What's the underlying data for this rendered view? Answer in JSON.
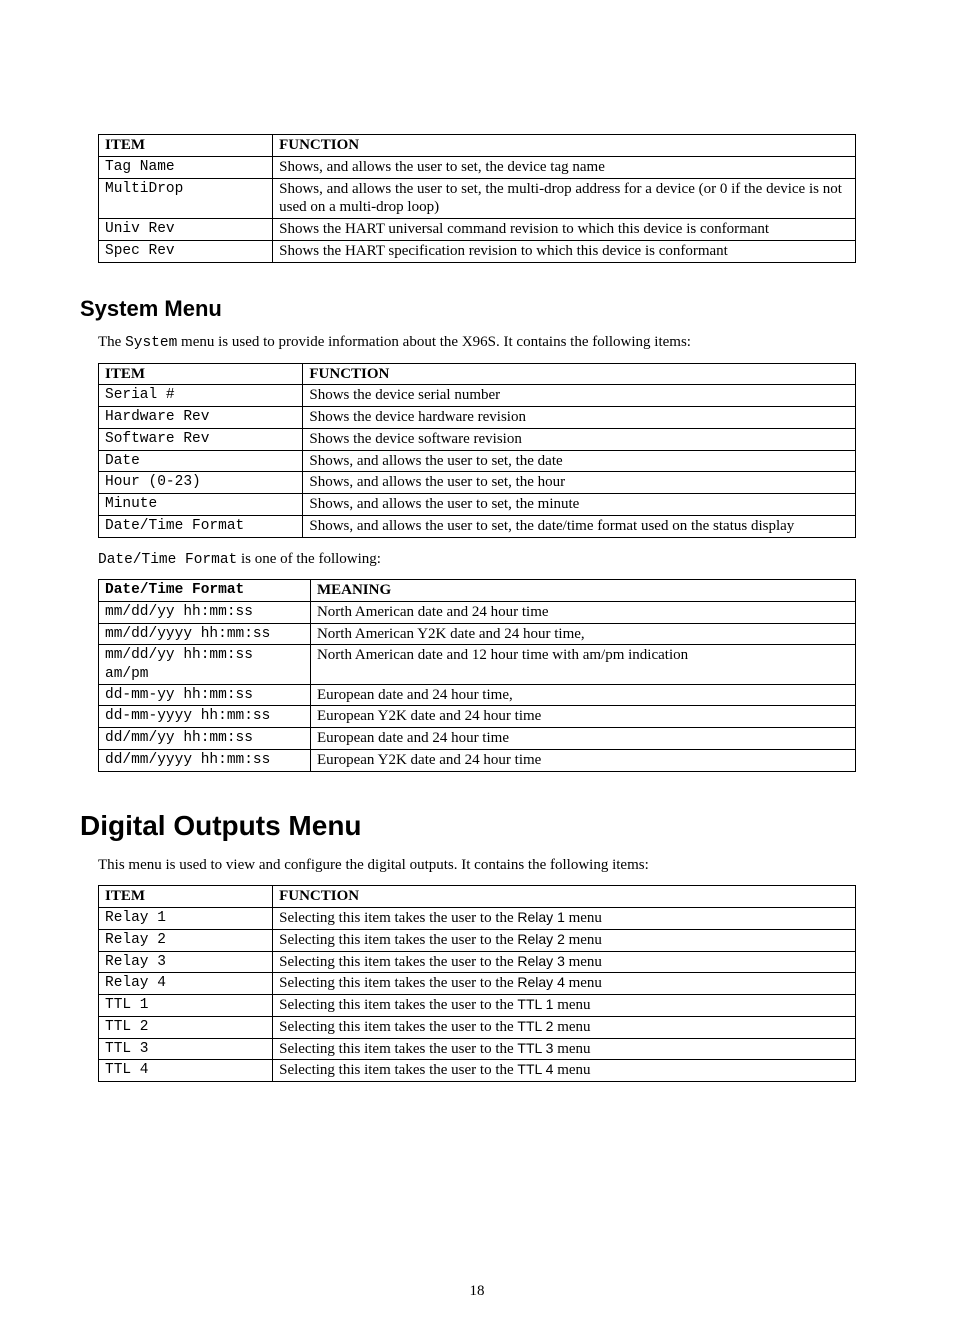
{
  "table1": {
    "headers": [
      "ITEM",
      "FUNCTION"
    ],
    "rows": [
      {
        "item": "Tag Name",
        "func": "Shows, and allows the user to set,  the device tag name"
      },
      {
        "item": "MultiDrop",
        "func": "Shows, and allows the user to set,  the multi-drop address for a device (or 0 if the device is not used on a multi-drop loop)"
      },
      {
        "item": "Univ Rev",
        "func": "Shows the HART universal command revision to which this device is conformant"
      },
      {
        "item": "Spec Rev",
        "func": "Shows the HART specification revision to which this device is conformant"
      }
    ]
  },
  "systemMenu": {
    "heading": "System Menu",
    "intro_prefix": "The ",
    "intro_mono": "System",
    "intro_suffix": " menu is used to provide information about the X96S. It contains the following items:"
  },
  "table2": {
    "headers": [
      "ITEM",
      "FUNCTION"
    ],
    "rows": [
      {
        "item": "Serial #",
        "func": "Shows the device serial number"
      },
      {
        "item": "Hardware Rev",
        "func": "Shows the device hardware revision"
      },
      {
        "item": "Software Rev",
        "func": "Shows the device software revision"
      },
      {
        "item": "Date",
        "func": "Shows, and allows the user to set,  the date"
      },
      {
        "item": "Hour (0-23)",
        "func": "Shows, and allows the user to set,  the hour"
      },
      {
        "item": "Minute",
        "func": "Shows, and allows the user to set,  the minute"
      },
      {
        "item": "Date/Time Format",
        "func": "Shows, and allows the user to set,  the date/time format used on the status display"
      }
    ]
  },
  "datetime_note_mono": "Date/Time Format",
  "datetime_note_suffix": " is one of the following:",
  "table3": {
    "headers": [
      "Date/Time Format",
      "MEANING"
    ],
    "rows": [
      {
        "item": "mm/dd/yy hh:mm:ss",
        "func": "North American date and 24 hour time"
      },
      {
        "item": "mm/dd/yyyy hh:mm:ss",
        "func": "North American Y2K date and 24 hour time,"
      },
      {
        "item": "mm/dd/yy hh:mm:ss am/pm",
        "func": "North American date and 12 hour time with am/pm indication"
      },
      {
        "item": "dd-mm-yy hh:mm:ss",
        "func": "European date and 24 hour time,"
      },
      {
        "item": "dd-mm-yyyy hh:mm:ss",
        "func": "European Y2K date and 24 hour time"
      },
      {
        "item": "dd/mm/yy hh:mm:ss",
        "func": "European date and 24 hour time"
      },
      {
        "item": "dd/mm/yyyy hh:mm:ss",
        "func": "European Y2K date and 24 hour time"
      }
    ]
  },
  "digitalOutputs": {
    "heading": "Digital Outputs Menu",
    "intro": "This menu is used to view and configure the digital outputs.  It contains the following items:"
  },
  "table4": {
    "headers": [
      "ITEM",
      "FUNCTION"
    ],
    "rows": [
      {
        "item": "Relay 1",
        "func_prefix": "Selecting this item takes the user to the ",
        "func_sans": "Relay 1",
        "func_suffix": " menu"
      },
      {
        "item": "Relay 2",
        "func_prefix": "Selecting this item takes the user to the ",
        "func_sans": "Relay 2",
        "func_suffix": " menu"
      },
      {
        "item": "Relay 3",
        "func_prefix": "Selecting this item takes the user to the ",
        "func_sans": "Relay 3",
        "func_suffix": " menu"
      },
      {
        "item": "Relay 4",
        "func_prefix": "Selecting this item takes the user to the ",
        "func_sans": "Relay 4",
        "func_suffix": " menu"
      },
      {
        "item": "TTL 1",
        "func_prefix": "Selecting this item takes the user to the ",
        "func_sans": "TTL 1",
        "func_suffix": " menu"
      },
      {
        "item": "TTL 2",
        "func_prefix": "Selecting this item takes the user to the ",
        "func_sans": "TTL 2",
        "func_suffix": " menu"
      },
      {
        "item": "TTL 3",
        "func_prefix": "Selecting this item takes the user to the ",
        "func_sans": "TTL 3",
        "func_suffix": " menu"
      },
      {
        "item": "TTL 4",
        "func_prefix": "Selecting this item takes the user to the ",
        "func_sans": "TTL 4",
        "func_suffix": " menu"
      }
    ]
  },
  "page_number": "18"
}
